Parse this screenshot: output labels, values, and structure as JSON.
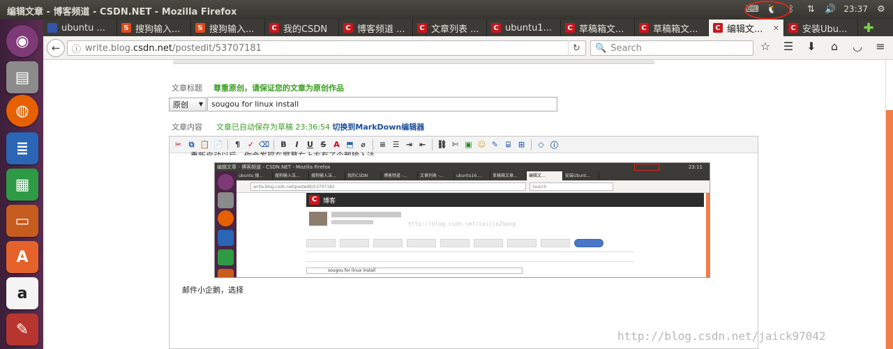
{
  "window": {
    "title": "编辑文章 - 博客频道 - CSDN.NET - Mozilla Firefox",
    "clock": "23:37"
  },
  "tabs": [
    {
      "label": "ubuntu ...",
      "fav_color": "#3355aa",
      "fav_glyph": ""
    },
    {
      "label": "搜狗输入...",
      "fav_color": "#e04a1a",
      "fav_glyph": "S"
    },
    {
      "label": "搜狗输入...",
      "fav_color": "#e04a1a",
      "fav_glyph": "S"
    },
    {
      "label": "我的CSDN",
      "fav_color": "#c9161d",
      "fav_glyph": "C"
    },
    {
      "label": "博客频道 ...",
      "fav_color": "#c9161d",
      "fav_glyph": "C"
    },
    {
      "label": "文章列表 ...",
      "fav_color": "#c9161d",
      "fav_glyph": "C"
    },
    {
      "label": "ubuntu1...",
      "fav_color": "#c9161d",
      "fav_glyph": "C"
    },
    {
      "label": "草稿箱文...",
      "fav_color": "#c9161d",
      "fav_glyph": "C"
    },
    {
      "label": "草稿箱文...",
      "fav_color": "#c9161d",
      "fav_glyph": "C"
    },
    {
      "label": "编辑文...",
      "fav_color": "#c9161d",
      "fav_glyph": "C",
      "active": true
    },
    {
      "label": "安装Ubu...",
      "fav_color": "#c9161d",
      "fav_glyph": "C"
    }
  ],
  "nav": {
    "url_host": "write.blog.",
    "url_domain": "csdn.net",
    "url_path": "/postedit/53707181",
    "search_placeholder": "Search"
  },
  "form": {
    "title_label": "文章标题",
    "title_notice": "尊重原创，请保证您的文章为原创作品",
    "type_value": "原创",
    "title_value": "sougou for linux install",
    "content_label": "文章内容",
    "autosave_text": "文章已自动保存为草稿 23:36:54",
    "markdown_link": "切换到MarkDown编辑器"
  },
  "editor": {
    "cut_text": "重新启动以后，你会发现在屏幕右上方有了企鹅输入法",
    "caption": "邮件小企鹅，选择"
  },
  "embedded": {
    "window_title": "编辑文章 - 博客频道 - CSDN.NET - Mozilla Firefox",
    "clock": "23:11",
    "tabs": [
      "ubuntu 搜...",
      "搜狗输入法...",
      "搜狗输入法...",
      "我的CSDN",
      "博客频道 -...",
      "文章列表 -...",
      "ubuntu16....",
      "草稿箱文章...",
      "编辑文...",
      "安装Ubunt..."
    ],
    "url": "write.blog.csdn.net/postedit/53707181",
    "search": "Search",
    "blog_title": "博客",
    "watermark": "http://blog.csdn.net/leijieZhang",
    "title_value": "sougou for linux install",
    "type_value": "原创"
  },
  "watermark": "http://blog.csdn.net/jaick97042"
}
